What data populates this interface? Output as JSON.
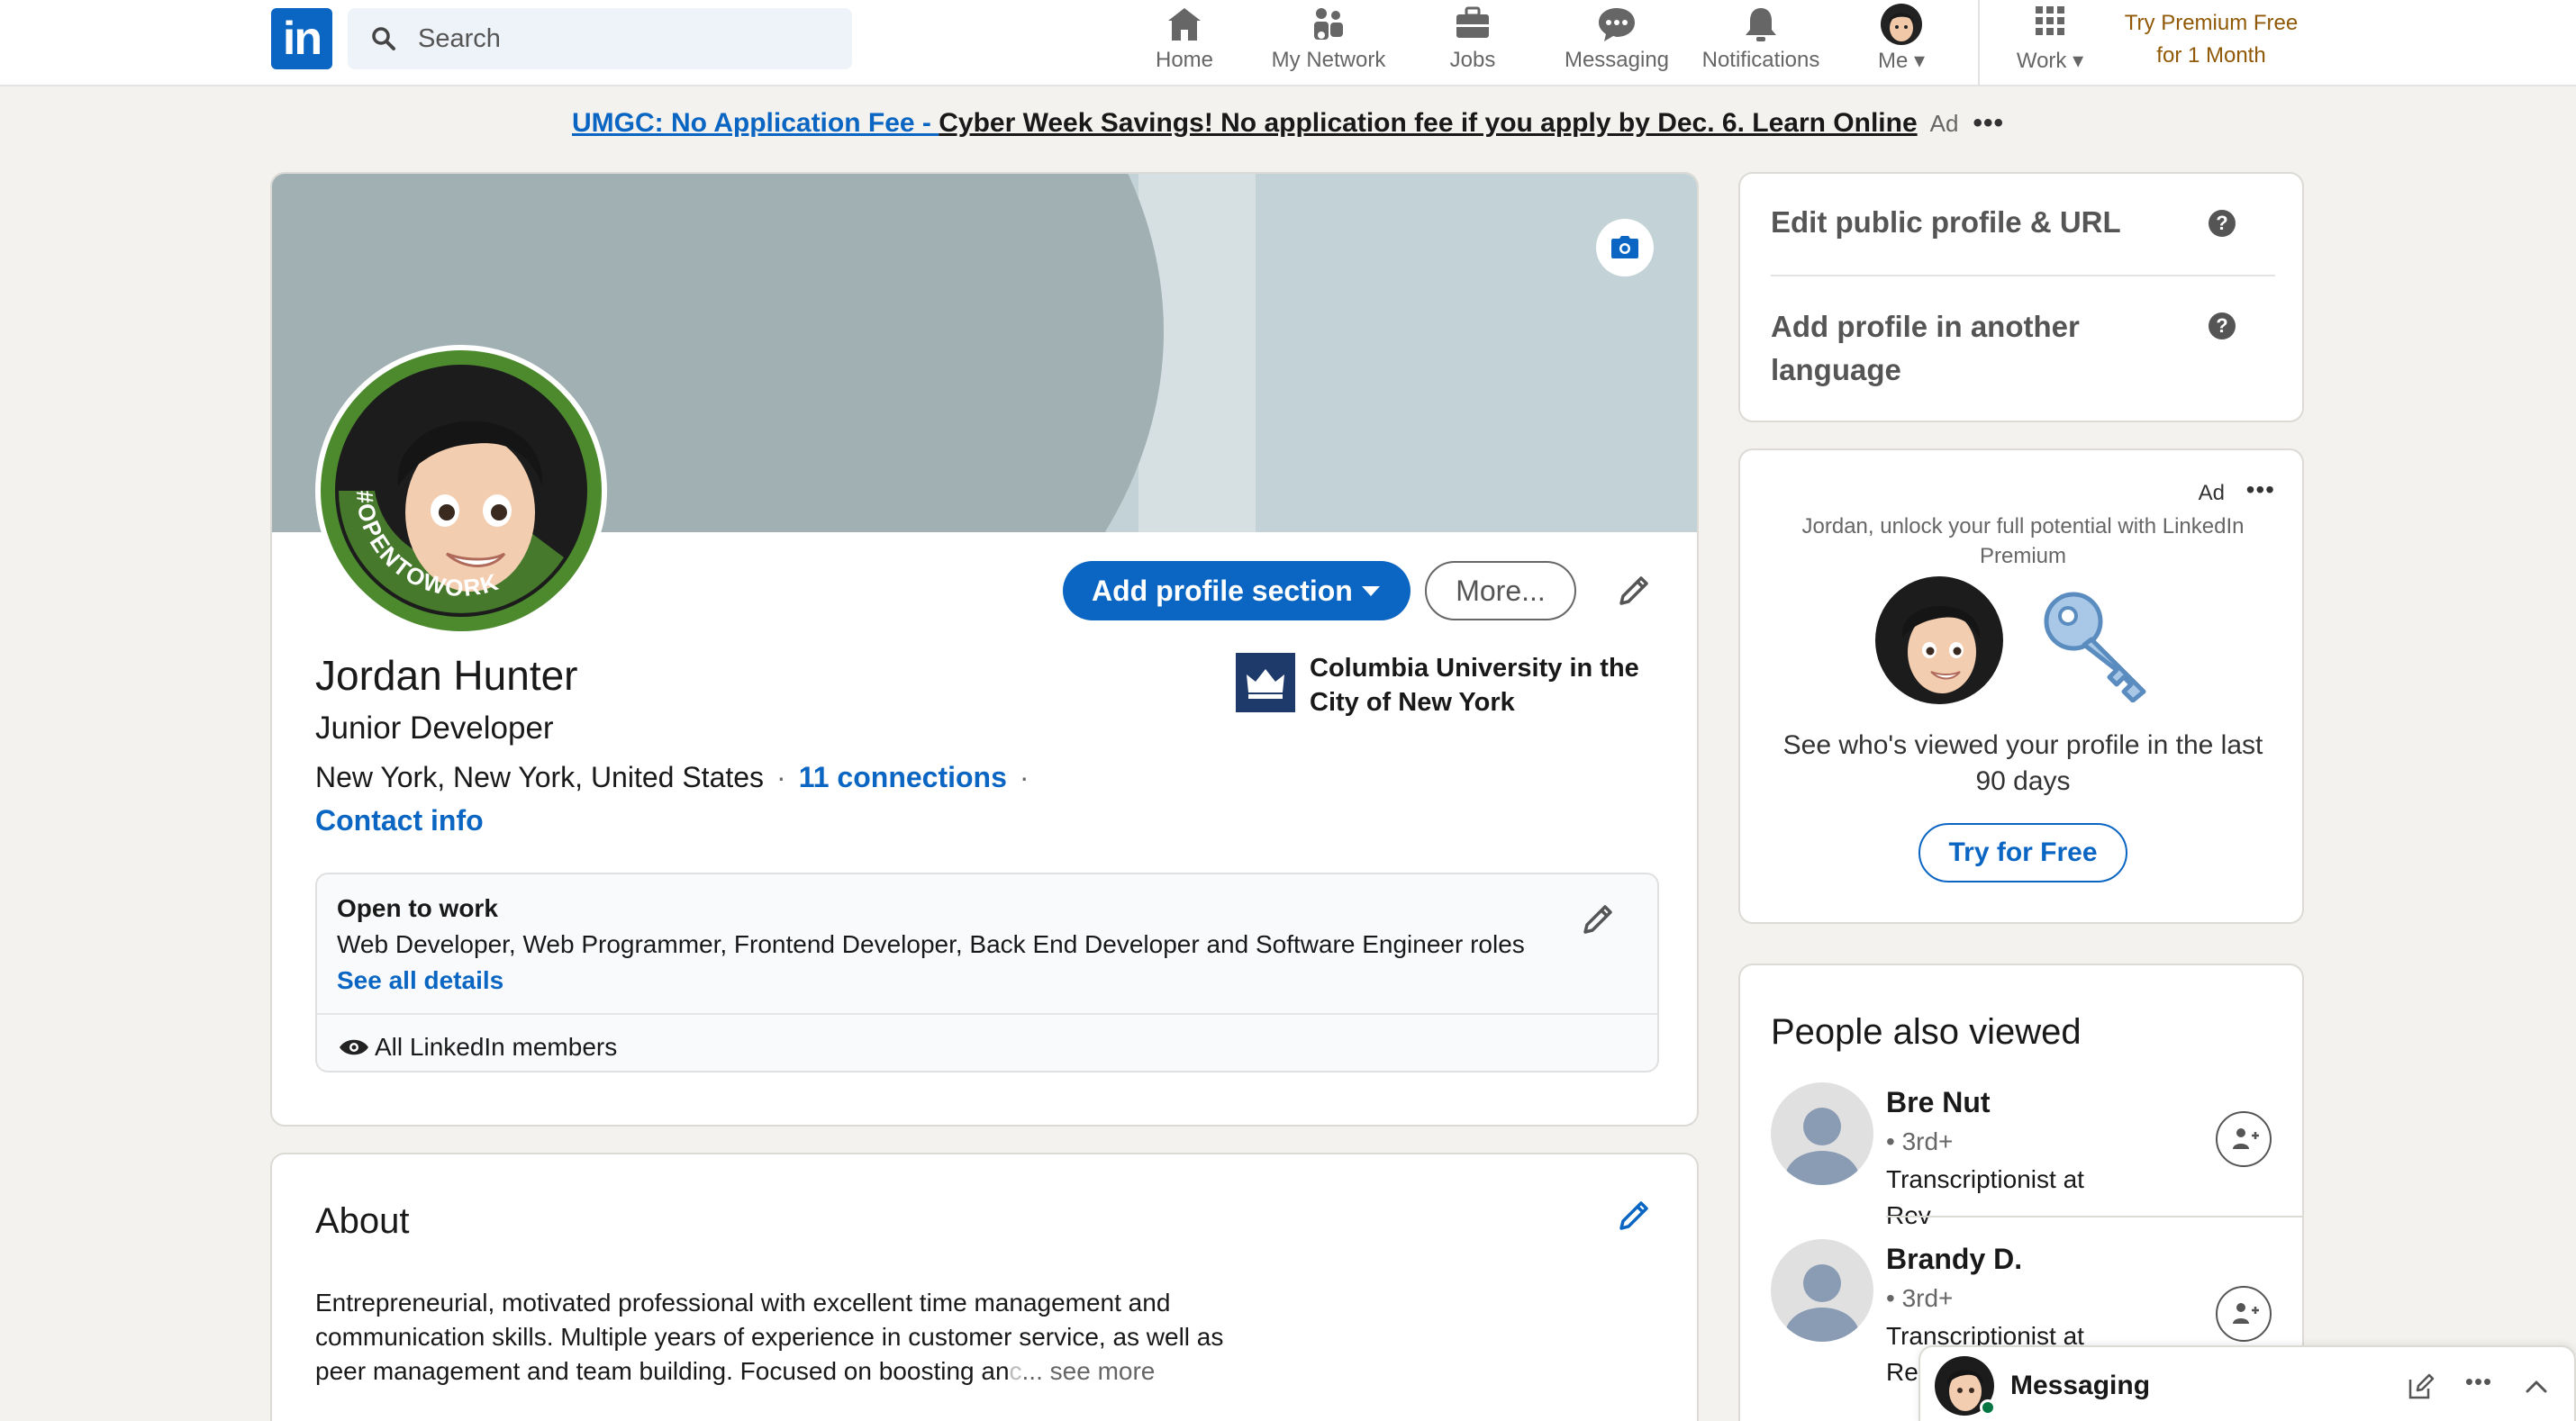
{
  "nav": {
    "logo_text": "in",
    "search_placeholder": "Search",
    "items": [
      {
        "label": "Home",
        "icon": "home-icon"
      },
      {
        "label": "My Network",
        "icon": "network-icon"
      },
      {
        "label": "Jobs",
        "icon": "briefcase-icon"
      },
      {
        "label": "Messaging",
        "icon": "chat-icon"
      },
      {
        "label": "Notifications",
        "icon": "bell-icon"
      },
      {
        "label": "Me",
        "icon": "avatar-icon"
      },
      {
        "label": "Work",
        "icon": "grid-icon"
      }
    ],
    "premium_line1": "Try Premium Free",
    "premium_line2": "for 1 Month"
  },
  "ad_banner": {
    "link": "UMGC: No Application Fee - ",
    "text": "Cyber Week Savings! No application fee if you apply by Dec. 6. Learn Online",
    "tag": "Ad",
    "dots": "•••"
  },
  "profile": {
    "add_section_label": "Add profile section",
    "more_label": "More...",
    "open_to_work_badge": "#OPENTOWORK",
    "name": "Jordan Hunter",
    "headline": "Junior Developer",
    "location": "New York, New York, United States",
    "dot": "·",
    "connections": "11 connections",
    "contact": "Contact info",
    "school": "Columbia University in the City of New York",
    "open_to_work": {
      "title": "Open to work",
      "roles": "Web Developer, Web Programmer, Frontend Developer, Back End Developer and Software Engineer roles",
      "see_all": "See all details",
      "visibility": "All LinkedIn members"
    }
  },
  "about": {
    "title": "About",
    "text_visible": "Entrepreneurial, motivated professional with excellent time management and communication skills. Multiple years of experience in customer service, as well as peer management and team building. Focused on boosting an",
    "text_fade": "c",
    "see_more": "... see more"
  },
  "sidebar": {
    "edit_public": "Edit public profile & URL",
    "add_language": "Add profile in another language",
    "help_glyph": "?"
  },
  "premium_ad": {
    "tag": "Ad",
    "dots": "•••",
    "tagline": "Jordan, unlock your full potential with LinkedIn Premium",
    "pitch": "See who's viewed your profile in the last 90 days",
    "cta": "Try for Free"
  },
  "people_also_viewed": {
    "title": "People also viewed",
    "people": [
      {
        "name": "Bre Nut",
        "degree": "• 3rd+",
        "job": "Transcriptionist at Rev"
      },
      {
        "name": "Brandy D.",
        "degree": "• 3rd+",
        "job": "Transcriptionist at Rev"
      }
    ]
  },
  "messaging_bar": {
    "label": "Messaging",
    "dots": "•••"
  },
  "colors": {
    "brand": "#0a66c2",
    "premium": "#915907",
    "open_to_work_ring": "#4d8a2e"
  }
}
